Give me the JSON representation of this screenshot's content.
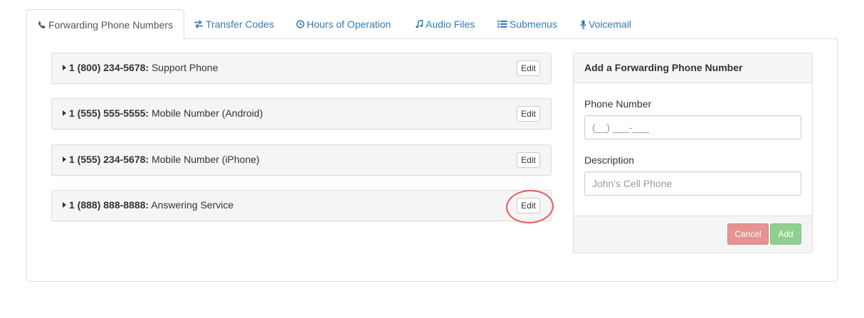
{
  "tabs": [
    {
      "label": "Forwarding Phone Numbers",
      "icon": "phone-icon",
      "active": true
    },
    {
      "label": "Transfer Codes",
      "icon": "transfer-arrows-icon",
      "active": false
    },
    {
      "label": "Hours of Operation",
      "icon": "clock-icon",
      "active": false
    },
    {
      "label": "Audio Files",
      "icon": "music-note-icon",
      "active": false
    },
    {
      "label": "Submenus",
      "icon": "list-icon",
      "active": false
    },
    {
      "label": "Voicemail",
      "icon": "microphone-icon",
      "active": false
    }
  ],
  "numbers": [
    {
      "number": "1 (800) 234-5678:",
      "description": "Support Phone",
      "edit_label": "Edit"
    },
    {
      "number": "1 (555) 555-5555:",
      "description": "Mobile Number (Android)",
      "edit_label": "Edit"
    },
    {
      "number": "1 (555) 234-5678:",
      "description": "Mobile Number (iPhone)",
      "edit_label": "Edit"
    },
    {
      "number": "1 (888) 888-8888:",
      "description": "Answering Service",
      "edit_label": "Edit"
    }
  ],
  "add_form": {
    "title": "Add a Forwarding Phone Number",
    "phone_label": "Phone Number",
    "phone_placeholder": "(__) ___-___",
    "description_label": "Description",
    "description_placeholder": "John's Cell Phone",
    "cancel_label": "Cancel",
    "add_label": "Add"
  },
  "colors": {
    "link": "#337ab7",
    "cancel": "#e59491",
    "add": "#91cf91",
    "highlight_circle": "#e04040"
  }
}
